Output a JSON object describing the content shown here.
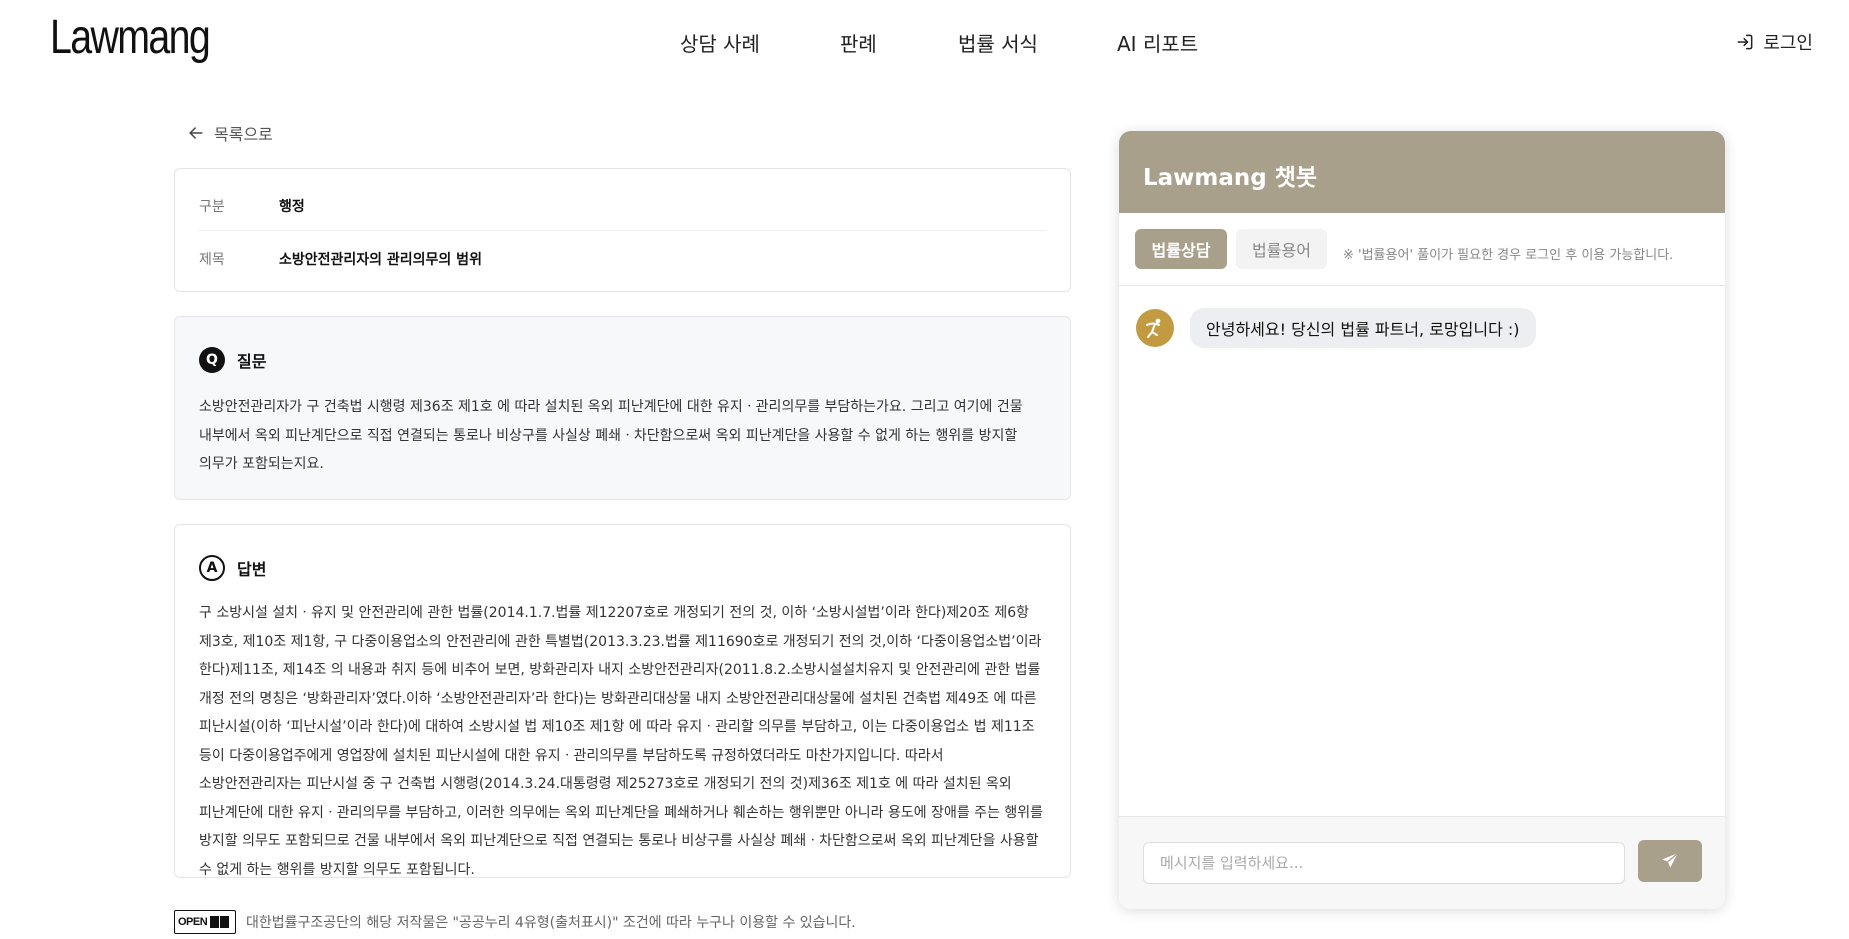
{
  "header": {
    "logo": "Lawmang",
    "nav": [
      "상담 사례",
      "판례",
      "법률 서식",
      "AI 리포트"
    ],
    "login_label": "로그인"
  },
  "back_label": "목록으로",
  "meta": {
    "category_key": "구분",
    "category_value": "행정",
    "title_key": "제목",
    "title_value": "소방안전관리자의 관리의무의 범위"
  },
  "question": {
    "badge": "Q",
    "heading": "질문",
    "text": "소방안전관리자가 구 건축법 시행령 제36조 제1호 에 따라 설치된 옥외 피난계단에 대한 유지ㆍ관리의무를 부담하는가요. 그리고 여기에 건물 내부에서 옥외 피난계단으로 직접 연결되는 통로나 비상구를 사실상 폐쇄ㆍ차단함으로써 옥외 피난계단을 사용할 수 없게 하는 행위를 방지할 의무가 포함되는지요."
  },
  "answer": {
    "badge": "A",
    "heading": "답변",
    "text": "구 소방시설 설치ㆍ유지 및 안전관리에 관한 법률(2014.1.7.법률 제12207호로 개정되기 전의 것, 이하 ‘소방시설법’이라 한다)제20조 제6항 제3호, 제10조 제1항, 구 다중이용업소의 안전관리에 관한 특별법(2013.3.23.법률 제11690호로 개정되기 전의 것,이하 ‘다중이용업소법’이라 한다)제11조, 제14조 의 내용과 취지 등에 비추어 보면, 방화관리자 내지 소방안전관리자(2011.8.2.소방시설설치유지 및 안전관리에 관한 법률 개정 전의 명칭은 ‘방화관리자’였다.이하 ‘소방안전관리자’라 한다)는 방화관리대상물 내지 소방안전관리대상물에 설치된 건축법 제49조 에 따른 피난시설(이하 ‘피난시설’이라 한다)에 대하여 소방시설 법 제10조 제1항 에 따라 유지ㆍ관리할 의무를 부담하고, 이는 다중이용업소 법 제11조 등이 다중이용업주에게 영업장에 설치된 피난시설에 대한 유지ㆍ관리의무를 부담하도록 규정하였더라도 마찬가지입니다. 따라서 소방안전관리자는 피난시설 중 구 건축법 시행령(2014.3.24.대통령령 제25273호로 개정되기 전의 것)제36조 제1호 에 따라 설치된 옥외 피난계단에 대한 유지ㆍ관리의무를 부담하고, 이러한 의무에는 옥외 피난계단을 폐쇄하거나 훼손하는 행위뿐만 아니라 용도에 장애를 주는 행위를 방지할 의무도 포함되므로 건물 내부에서 옥외 피난계단으로 직접 연결되는 통로나 비상구를 사실상 폐쇄ㆍ차단함으로써 옥외 피난계단을 사용할 수 없게 하는 행위를 방지할 의무도 포함됩니다."
  },
  "license": {
    "badge": "OPEN",
    "text": "대한법률구조공단의 해당 저작물은 \"공공누리 4유형(출처표시)\" 조건에 따라 누구나 이용할 수 있습니다."
  },
  "chat": {
    "title": "Lawmang 챗봇",
    "tab_active": "법률상담",
    "tab_inactive": "법률용어",
    "tab_note": "※ '법률용어' 풀이가 필요한 경우 로그인 후 이용 가능합니다.",
    "greeting": "안녕하세요! 당신의 법률 파트너, 로망입니다 :)",
    "input_placeholder": "메시지를 입력하세요...",
    "input_value": ""
  },
  "colors": {
    "accent": "#a8a08b",
    "avatar": "#c29a3f",
    "question_bg": "#f7f8fa"
  },
  "icons": [
    "arrow-left-icon",
    "login-icon",
    "send-icon",
    "avatar-logo-icon"
  ]
}
